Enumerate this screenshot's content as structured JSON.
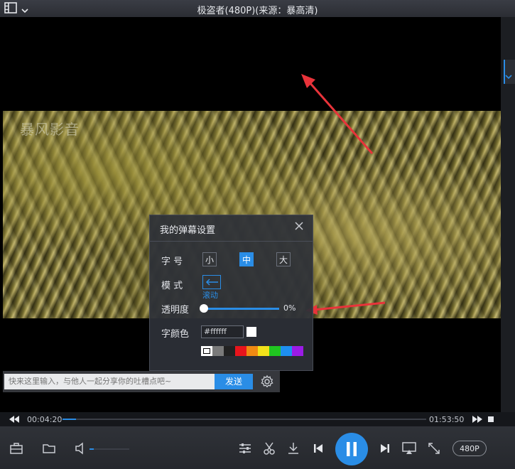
{
  "window": {
    "title": "极盗者(480P)(来源：暴高清)"
  },
  "video": {
    "watermark": "暴风影音"
  },
  "danmaku_panel": {
    "title": "我的弹幕设置",
    "size": {
      "label": "字 号",
      "options": [
        "小",
        "中",
        "大"
      ],
      "selected": "中"
    },
    "mode": {
      "label": "模 式",
      "option": "滚动"
    },
    "opacity": {
      "label": "透明度",
      "value": "0%"
    },
    "font_color": {
      "label": "字颜色",
      "hex": "#ffffff",
      "palette": [
        "#ffffff",
        "#7a7a7a",
        "#222222",
        "#e8141c",
        "#f08a12",
        "#f2e21a",
        "#20c520",
        "#1e8ff0",
        "#9b1be6"
      ]
    }
  },
  "comment_bar": {
    "placeholder": "快来这里输入，与他人一起分享你的吐槽点吧~",
    "send_label": "发送"
  },
  "playback": {
    "current_time": "00:04:20",
    "total_time": "01:53:50",
    "progress": 0.038
  },
  "controls": {
    "quality_label": "480P",
    "volume": 0.1
  },
  "colors": {
    "accent": "#2a8de6",
    "annotation_arrow": "#e8333a"
  }
}
